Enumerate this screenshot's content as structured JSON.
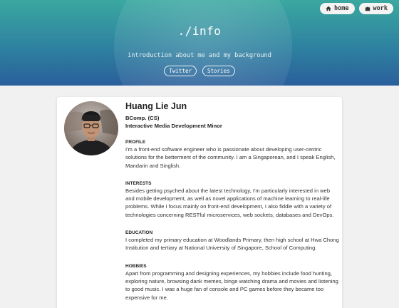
{
  "nav": {
    "home_label": "home",
    "work_label": "work",
    "home_icon": "home-icon",
    "work_icon": "briefcase-icon"
  },
  "hero": {
    "title": "./info",
    "subtitle": "introduction about me and my background",
    "links": [
      "Twitter",
      "Stories"
    ]
  },
  "profile": {
    "name": "Huang Lie Jun",
    "degree": "BComp. (CS)",
    "minor": "Interactive Media Development Minor",
    "sections": [
      {
        "title": "PROFILE",
        "body": "I'm a front-end software engineer who is passionate about developing user-centric solutions for the betterment of the community. I am a Singaporean, and I speak English, Mandarin and Singlish."
      },
      {
        "title": "INTERESTS",
        "body": "Besides getting psyched about the latest technology, I'm particularly interested in web and mobile development, as well as novel applications of machine learning to real-life problems. While I focus mainly on front-end development, I also fiddle with a variety of technologies concerning RESTful microservices, web sockets, databases and DevOps."
      },
      {
        "title": "EDUCATION",
        "body": "I completed my primary education at Woodlands Primary, then high school at Hwa Chong Institution and tertiary at National University of Singapore, School of Computing."
      },
      {
        "title": "HOBBIES",
        "body": "Apart from programming and designing experiences, my hobbies include food hunting, exploring nature, browsing dank memes, binge watching drama and movies and listening to good music. I was a huge fan of console and PC games before they became too expensive for me."
      }
    ]
  },
  "colors": {
    "hero_top": "#3aa8a0",
    "hero_bottom": "#2a5f9b",
    "page_bg": "#f1f1f1",
    "card_bg": "#ffffff"
  }
}
